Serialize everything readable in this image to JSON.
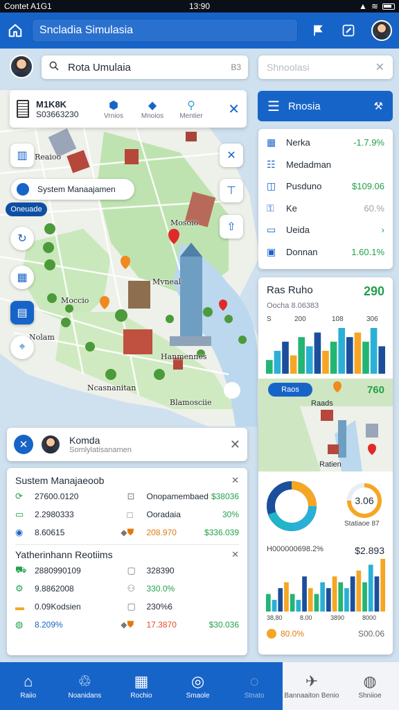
{
  "status": {
    "left": "Contet  A1G1",
    "time": "13:90"
  },
  "appbar": {
    "title": "Sncladia Simulasia",
    "icons": [
      "home-icon",
      "flag-icon",
      "edit-icon"
    ]
  },
  "search": {
    "value": "Rota Umulaia",
    "tail": "B3",
    "placeholder2": "Shnoolasi"
  },
  "toolcard": {
    "title": "M1K8K",
    "subtitle": "S03663230",
    "tools": [
      {
        "icon": "shield-icon",
        "label": "Vrnios"
      },
      {
        "icon": "layers-icon",
        "label": "Mnoios"
      },
      {
        "icon": "pin-icon",
        "label": "Mentier"
      }
    ]
  },
  "map": {
    "pill_label": "System Manaajamen",
    "tag_label": "Oneuade",
    "labels": [
      "Reaioo",
      "Mosoio",
      "Moccio",
      "Mvneal",
      "Nolam",
      "Hanmennes",
      "Ncasnanitan",
      "Blamosciie"
    ]
  },
  "rightpanel": {
    "header": "Rnosia",
    "rows": [
      {
        "icon": "grid-icon",
        "label": "Nerka",
        "value": "-1.7.9%",
        "color": "#22a04a"
      },
      {
        "icon": "list-icon",
        "label": "Medadman",
        "value": "",
        "color": "#222"
      },
      {
        "icon": "chart-icon",
        "label": "Pusduno",
        "value": "$109.06",
        "color": "#22a04a"
      },
      {
        "icon": "key-icon",
        "label": "Ke",
        "value": "60.%",
        "color": "#9aa3ad"
      },
      {
        "icon": "doc-icon",
        "label": "Ueida",
        "value": "›",
        "color": "#22a04a"
      },
      {
        "icon": "book-icon",
        "label": "Donnan",
        "value": "1.60.1%",
        "color": "#22a04a"
      }
    ]
  },
  "chart_card": {
    "title": "Ras Ruho",
    "value": "290",
    "sub": "Oocha 8.06383",
    "ticks": [
      "S",
      "200",
      "108",
      "306"
    ],
    "map_tag": "Raos",
    "map_value": "760",
    "map_labels": [
      "Raads",
      "Ratien"
    ],
    "donut_label": "Statiaoe 87",
    "ring_value": "3.06",
    "bottom_title": "H000000698.2%",
    "bottom_value": "$2.893",
    "bottom_ticks": [
      "38,80",
      "8.00",
      "3890",
      "8000"
    ],
    "footer_left": "80.0%",
    "footer_right": "S00.06"
  },
  "chart_data": [
    {
      "type": "bar",
      "title": "Ras Ruho",
      "series": [
        {
          "values": [
            3,
            5,
            7,
            4,
            8,
            6,
            9,
            5,
            7,
            10,
            8,
            9,
            7,
            10,
            6
          ]
        }
      ]
    },
    {
      "type": "bar",
      "title": "H000000698.2%",
      "series": [
        {
          "values": [
            3,
            2,
            4,
            5,
            3,
            2,
            6,
            4,
            3,
            5,
            4,
            6,
            5,
            4,
            6,
            7,
            5,
            8,
            6,
            9
          ]
        }
      ]
    }
  ],
  "ident": {
    "name": "Komda",
    "sub": "Somlylatisanamen"
  },
  "panel1": {
    "title": "Sustem Manajaeoob",
    "cells": [
      {
        "icon": "refresh-icon",
        "label": "27600.0120",
        "color": "#22a04a"
      },
      {
        "icon": "bag-icon",
        "label": "Onopamembaed",
        "value": "$38036",
        "color": "#22a04a"
      },
      {
        "icon": "card-icon",
        "label": "2.2980333",
        "color": "#22a04a"
      },
      {
        "icon": "box-icon",
        "label": "Ooradaia",
        "value": "30%",
        "color": "#22a04a"
      },
      {
        "icon": "globe-icon",
        "label": "8.60615",
        "color": "#333"
      },
      {
        "icon": "badge-icon",
        "label": "208.970",
        "value": "$336.039",
        "color": "#e07a10"
      }
    ]
  },
  "panel2": {
    "title": "Yatherinhann Reotiims",
    "cells": [
      {
        "icon": "truck-icon",
        "label": "2880990109",
        "color": "#333"
      },
      {
        "icon": "calc-icon",
        "label": "328390",
        "value": "",
        "color": "#333"
      },
      {
        "icon": "gear-icon",
        "label": "9.8862008",
        "color": "#22a04a"
      },
      {
        "icon": "person-icon",
        "label": "330.0%",
        "value": "",
        "color": "#22a04a"
      },
      {
        "icon": "folder-icon",
        "label": "0.09Kodsien",
        "color": "#333"
      },
      {
        "icon": "tray-icon",
        "label": "230%6",
        "value": "",
        "color": "#333"
      },
      {
        "icon": "leaf-icon",
        "label": "8.209%",
        "color": "#22a04a"
      },
      {
        "icon": "badge-icon",
        "label": "17.3870",
        "value": "$30.036",
        "color": "#e07a10"
      }
    ]
  },
  "nav": {
    "items": [
      "Raiio",
      "Noanidans",
      "Rochio",
      "Smaole",
      "Stnato"
    ],
    "active": [
      "Bannaaiton Benio",
      "Shniioe"
    ]
  }
}
